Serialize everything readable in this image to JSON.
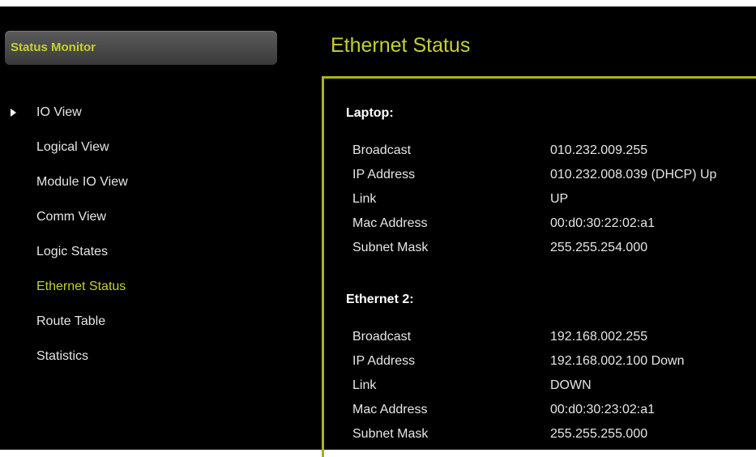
{
  "sidebar": {
    "header": "Status Monitor",
    "items": [
      {
        "label": "IO View"
      },
      {
        "label": "Logical View"
      },
      {
        "label": "Module IO View"
      },
      {
        "label": "Comm View"
      },
      {
        "label": "Logic States"
      },
      {
        "label": "Ethernet Status"
      },
      {
        "label": "Route Table"
      },
      {
        "label": "Statistics"
      }
    ],
    "active_item": "Ethernet Status",
    "arrow_item": "IO View"
  },
  "main": {
    "title": "Ethernet Status",
    "sections": [
      {
        "title": "Laptop:",
        "rows": [
          {
            "key": "Broadcast",
            "value": "010.232.009.255"
          },
          {
            "key": "IP Address",
            "value": "010.232.008.039 (DHCP) Up"
          },
          {
            "key": "Link",
            "value": "UP"
          },
          {
            "key": "Mac Address",
            "value": "00:d0:30:22:02:a1"
          },
          {
            "key": "Subnet Mask",
            "value": "255.255.254.000"
          }
        ]
      },
      {
        "title": "Ethernet 2:",
        "rows": [
          {
            "key": "Broadcast",
            "value": "192.168.002.255"
          },
          {
            "key": "IP Address",
            "value": "192.168.002.100 Down"
          },
          {
            "key": "Link",
            "value": "DOWN"
          },
          {
            "key": "Mac Address",
            "value": "00:d0:30:23:02:a1"
          },
          {
            "key": "Subnet Mask",
            "value": "255.255.255.000"
          }
        ]
      }
    ]
  },
  "colors": {
    "accent": "#c5d12c",
    "panel_border": "#a7b21f",
    "background": "#000000",
    "text": "#e6e6e6"
  }
}
